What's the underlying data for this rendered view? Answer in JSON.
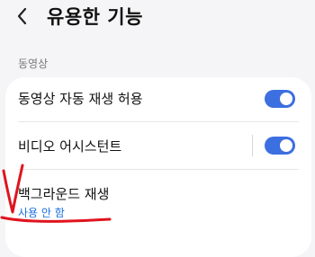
{
  "header": {
    "title": "유용한 기능"
  },
  "section": {
    "label": "동영상"
  },
  "rows": [
    {
      "label": "동영상 자동 재생 허용",
      "toggle": "on"
    },
    {
      "label": "비디오 어시스턴트",
      "toggle": "on"
    },
    {
      "label": "백그라운드 재생",
      "sub": "사용 안 함"
    }
  ],
  "colors": {
    "accent": "#3c6fe0",
    "link": "#1a6fe0",
    "annotation": "#e0141e",
    "background": "#f5f5f7"
  },
  "icons": {
    "back": "chevron-left-icon"
  }
}
